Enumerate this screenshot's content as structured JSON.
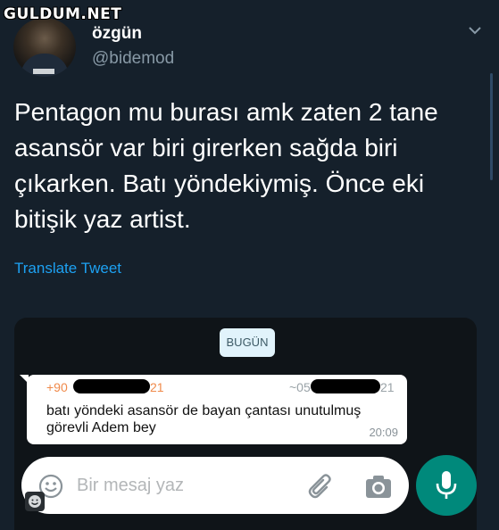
{
  "watermark": "GULDUM.NET",
  "tweet": {
    "user_name": "özgün",
    "handle": "@bidemod",
    "text_lines": [
      "Pentagon mu burası amk zaten 2 tane",
      "asansör var biri girerken sağda biri",
      "çıkarken. Batı yöndekiymiş. Önce eki",
      "bitişik yaz artist."
    ],
    "translate_label": "Translate Tweet"
  },
  "chat": {
    "date_chip": "BUGÜN",
    "message": {
      "sender_left": "+90",
      "sender_left_tail": "21",
      "sender_right": "~05",
      "sender_right_tail": "21",
      "line1": "batı yöndeki asansör de  bayan çantası unutulmuş",
      "line2": "görevli Adem bey",
      "time": "20:09"
    },
    "input_placeholder": "Bir mesaj yaz"
  },
  "colors": {
    "background": "#15202b",
    "link": "#1da1f2",
    "mic_button": "#00897b"
  },
  "icons": [
    "chevron-down-icon",
    "emoji-icon",
    "paperclip-icon",
    "camera-icon",
    "microphone-icon"
  ]
}
